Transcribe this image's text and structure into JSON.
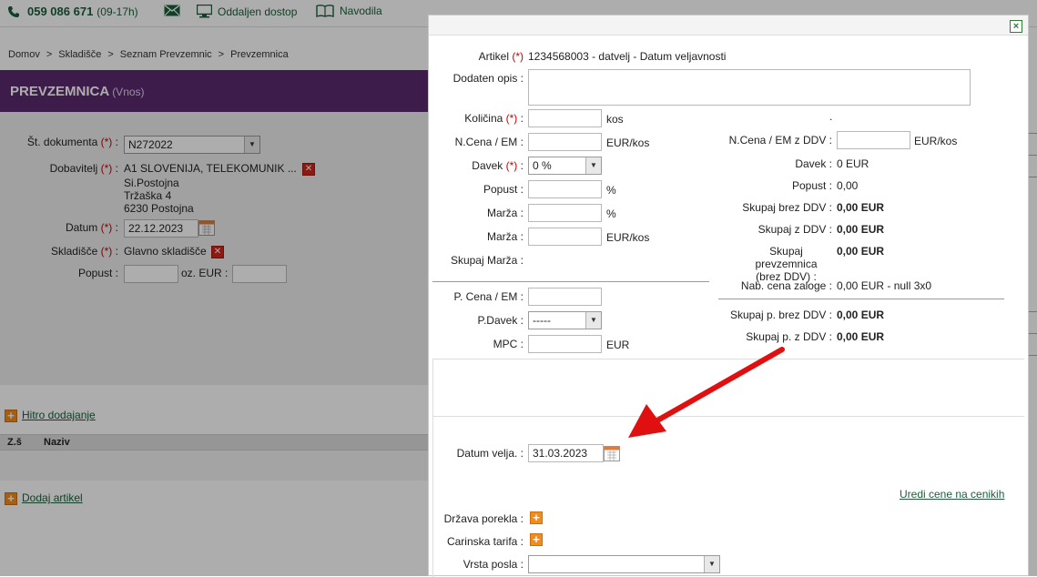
{
  "topbar": {
    "phone": "059 086 671",
    "phone_hours": "(09-17h)",
    "remote_access": "Oddaljen dostop",
    "instructions": "Navodila"
  },
  "breadcrumb": [
    "Domov",
    "Skladišče",
    "Seznam Prevzemnic",
    "Prevzemnica"
  ],
  "breadcrumb_sep": ">",
  "page": {
    "title": "PREVZEMNICA",
    "subtitle": "(Vnos)"
  },
  "form": {
    "doc_no_label": "Št. dokumenta",
    "doc_no_value": "N272022",
    "supplier_label": "Dobavitelj",
    "supplier_name": "A1 SLOVENIJA, TELEKOMUNIK ...",
    "supplier_line2": "Si.Postojna",
    "supplier_line3": "Tržaška 4",
    "supplier_line4": "6230 Postojna",
    "date_label": "Datum",
    "date_value": "22.12.2023",
    "warehouse_label": "Skladišče",
    "warehouse_value": "Glavno skladišče",
    "discount_label": "Popust :",
    "discount_eur_label": "oz. EUR :",
    "required_mark": "(*)",
    "colon": ":"
  },
  "links": {
    "quick_add": "Hitro dodajanje",
    "add_article": "Dodaj artikel"
  },
  "table": {
    "columns": [
      "Z.š",
      "Naziv"
    ]
  },
  "modal": {
    "article_label": "Artikel",
    "article_value": "1234568003 - datvelj - Datum veljavnosti",
    "extra_desc_label": "Dodaten opis :",
    "qty_label": "Količina",
    "qty_unit": "kos",
    "price_label": "N.Cena / EM",
    "price_unit": "EUR/kos",
    "tax_label": "Davek",
    "tax_value": "0 %",
    "discount_label": "Popust :",
    "discount_unit": "%",
    "margin_label": "Marža :",
    "margin_unit": "%",
    "margin2_label": "Marža :",
    "margin2_unit": "EUR/kos",
    "total_margin_label": "Skupaj Marža :",
    "dot": ".",
    "price_vat_label": "N.Cena / EM z DDV :",
    "price_vat_unit": "EUR/kos",
    "tax_r_label": "Davek :",
    "tax_r_value": "0 EUR",
    "discount_r_label": "Popust :",
    "discount_r_value": "0,00",
    "total_no_vat_label": "Skupaj brez DDV :",
    "total_no_vat_value": "0,00 EUR",
    "total_vat_label": "Skupaj z DDV :",
    "total_vat_value": "0,00 EUR",
    "total_receipt_label1": "Skupaj prevzemnica",
    "total_receipt_label2": "(brez DDV) :",
    "total_receipt_value": "0,00 EUR",
    "stock_price_label": "Nab. cena zaloge :",
    "stock_price_value": "0,00 EUR - null 3x0",
    "p_price_label": "P. Cena / EM :",
    "p_tax_label": "P.Davek :",
    "p_tax_value": "-----",
    "mpc_label": "MPC :",
    "mpc_unit": "EUR",
    "total_p_no_vat_label": "Skupaj p. brez DDV :",
    "total_p_no_vat_value": "0,00 EUR",
    "total_p_vat_label": "Skupaj p. z DDV :",
    "total_p_vat_value": "0,00 EUR",
    "expiry_label": "Datum velja. :",
    "expiry_value": "31.03.2023",
    "edit_prices_link": "Uredi cene na cenikih",
    "origin_label": "Država porekla :",
    "tariff_label": "Carinska tarifa :",
    "deal_type_label": "Vrsta posla :",
    "close_glyph": "×",
    "required_mark": "(*)",
    "colon": ":"
  },
  "colors": {
    "brand_purple": "#5b2a70",
    "link_green": "#1a5e3a",
    "required_red": "#cc0000",
    "arrow_red": "#e01010",
    "plus_orange": "#f28c1c"
  }
}
